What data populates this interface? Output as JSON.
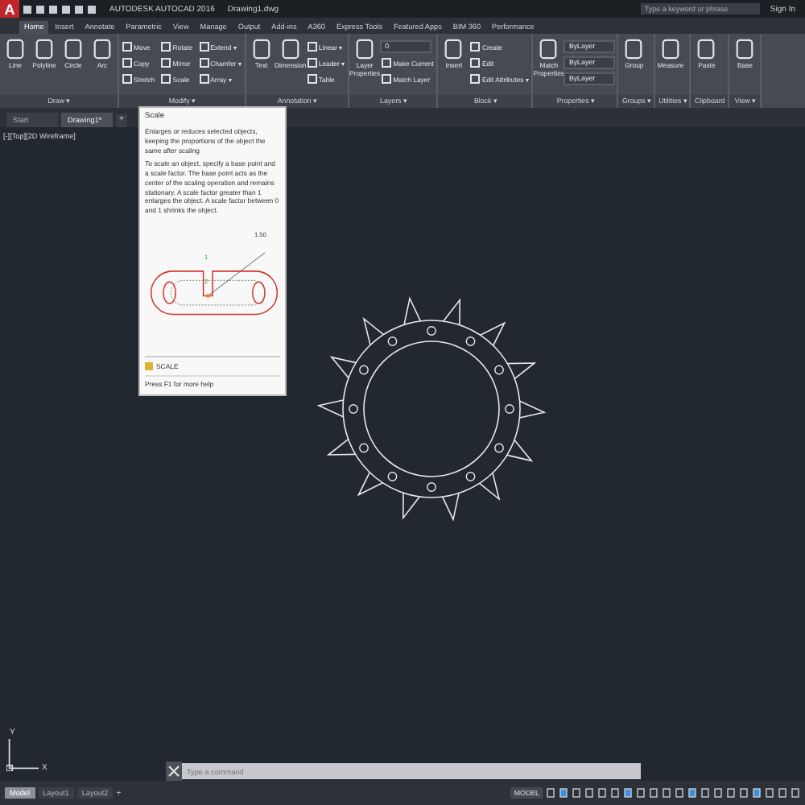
{
  "title_bar": {
    "logo": "A",
    "title": "AUTODESK AUTOCAD 2016",
    "file": "Drawing1.dwg",
    "search": {
      "placeholder": "Type a keyword or phrase"
    },
    "sign_in": "Sign In"
  },
  "ribbon_tabs": [
    {
      "label": "Home",
      "selected": true
    },
    {
      "label": "Insert",
      "selected": false
    },
    {
      "label": "Annotate",
      "selected": false
    },
    {
      "label": "Parametric",
      "selected": false
    },
    {
      "label": "View",
      "selected": false
    },
    {
      "label": "Manage",
      "selected": false
    },
    {
      "label": "Output",
      "selected": false
    },
    {
      "label": "Add-ins",
      "selected": false
    },
    {
      "label": "A360",
      "selected": false
    },
    {
      "label": "Express Tools",
      "selected": false
    },
    {
      "label": "Featured Apps",
      "selected": false
    },
    {
      "label": "BIM 360",
      "selected": false
    },
    {
      "label": "Performance",
      "selected": false
    }
  ],
  "panels": [
    {
      "title": "Draw ▾",
      "tools": [
        {
          "kind": "big",
          "label": "Line"
        },
        {
          "kind": "big",
          "label": "Polyline"
        },
        {
          "kind": "big",
          "label": "Circle"
        },
        {
          "kind": "big",
          "label": "Arc"
        }
      ]
    },
    {
      "title": "Modify ▾",
      "tools": [
        {
          "kind": "small",
          "label": "Move"
        },
        {
          "kind": "small",
          "label": "Copy"
        },
        {
          "kind": "small",
          "label": "Stretch"
        },
        {
          "kind": "small",
          "label": "Rotate"
        },
        {
          "kind": "small",
          "label": "Mirror"
        },
        {
          "kind": "small",
          "label": "Scale"
        },
        {
          "kind": "small",
          "label": "Extend ▾"
        },
        {
          "kind": "small",
          "label": "Chamfer ▾"
        },
        {
          "kind": "small",
          "label": "Array ▾"
        }
      ]
    },
    {
      "title": "Annotation ▾",
      "tools": [
        {
          "kind": "big",
          "label": "Text"
        },
        {
          "kind": "big",
          "label": "Dimension"
        },
        {
          "kind": "small",
          "label": "Linear ▾"
        },
        {
          "kind": "small",
          "label": "Leader ▾"
        },
        {
          "kind": "small",
          "label": "Table"
        }
      ]
    },
    {
      "title": "Layers ▾",
      "tools": [
        {
          "kind": "big",
          "label": "Layer Properties"
        },
        {
          "kind": "dropdown",
          "label": "0"
        },
        {
          "kind": "small",
          "label": "Make Current"
        },
        {
          "kind": "small",
          "label": "Match Layer"
        }
      ]
    },
    {
      "title": "Block ▾",
      "tools": [
        {
          "kind": "big",
          "label": "Insert"
        },
        {
          "kind": "small",
          "label": "Create"
        },
        {
          "kind": "small",
          "label": "Edit"
        },
        {
          "kind": "small",
          "label": "Edit Attributes ▾"
        }
      ]
    },
    {
      "title": "Properties ▾",
      "tools": [
        {
          "kind": "big",
          "label": "Match Properties"
        },
        {
          "kind": "dropdown",
          "label": "ByLayer"
        },
        {
          "kind": "dropdown",
          "label": "ByLayer"
        },
        {
          "kind": "dropdown",
          "label": "ByLayer"
        }
      ]
    },
    {
      "title": "Groups ▾",
      "tools": [
        {
          "kind": "big",
          "label": "Group"
        }
      ]
    },
    {
      "title": "Utilities ▾",
      "tools": [
        {
          "kind": "big",
          "label": "Measure"
        }
      ]
    },
    {
      "title": "Clipboard",
      "tools": [
        {
          "kind": "big",
          "label": "Paste"
        }
      ]
    },
    {
      "title": "View ▾",
      "tools": [
        {
          "kind": "big",
          "label": "Base"
        }
      ]
    }
  ],
  "file_tabs": [
    {
      "label": "Start",
      "selected": false
    },
    {
      "label": "Drawing1*",
      "selected": true
    }
  ],
  "new_tab": "+",
  "viewport_label": "[-][Top][2D Wireframe]",
  "tooltip": {
    "title": "Scale",
    "summary": "Enlarges or reduces selected objects, keeping the proportions of the object the same after scaling",
    "details": "To scale an object, specify a base point and a scale factor. The base point acts as the center of the scaling operation and remains stationary. A scale factor greater than 1 enlarges the object. A scale factor between 0 and 1 shrinks the object.",
    "figure_labels": [
      "1.50",
      "1",
      "2"
    ],
    "command": "SCALE",
    "help": "Press F1 for more help"
  },
  "ucs": {
    "y": "Y",
    "x": "X"
  },
  "command_line": {
    "placeholder": "Type a command"
  },
  "layout_tabs": [
    {
      "label": "Model",
      "selected": true
    },
    {
      "label": "Layout1",
      "selected": false
    },
    {
      "label": "Layout2",
      "selected": false
    }
  ],
  "layout_add": "+",
  "status_mode": "MODEL"
}
